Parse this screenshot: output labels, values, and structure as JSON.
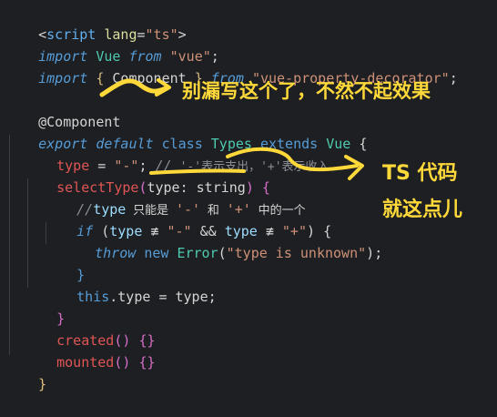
{
  "editor": {
    "lines": [
      {
        "id": "l1",
        "parts": [
          "<",
          "script",
          " lang",
          "=",
          "\"ts\"",
          ">"
        ]
      },
      {
        "id": "l2",
        "parts": [
          "import",
          " ",
          "Vue",
          " ",
          "from",
          " ",
          "\"vue\"",
          ";"
        ]
      },
      {
        "id": "l3",
        "parts": [
          "import",
          " ",
          "{",
          " ",
          "Component",
          " ",
          "}",
          " ",
          "from",
          " ",
          "\"vue-property-decorator\"",
          ";"
        ]
      },
      {
        "id": "l4",
        "parts": []
      },
      {
        "id": "l5",
        "parts": [
          "@Component"
        ]
      },
      {
        "id": "l6",
        "parts": [
          "export",
          " ",
          "default",
          " ",
          "class",
          " ",
          "Types",
          " ",
          "extends",
          " ",
          "Vue",
          " ",
          "{"
        ]
      },
      {
        "id": "l7",
        "parts": [
          "type",
          " ",
          "=",
          " ",
          "\"-\"",
          ";",
          " ",
          "//",
          " ",
          "'-'表示支出，'+'表示收入"
        ]
      },
      {
        "id": "l8",
        "parts": [
          "selectType",
          "(",
          "type",
          ":",
          " ",
          "string",
          ")",
          " ",
          "{"
        ]
      },
      {
        "id": "l9",
        "parts": [
          "//",
          "type",
          " 只能是 ",
          "'-'",
          " 和 ",
          "'+'",
          " 中的一个"
        ]
      },
      {
        "id": "l10",
        "parts": [
          "if",
          " ",
          "(",
          "type",
          " ",
          "≢",
          " ",
          "\"-\"",
          " ",
          "&&",
          " ",
          "type",
          " ",
          "≢",
          " ",
          "\"+\"",
          ")",
          " ",
          "{"
        ]
      },
      {
        "id": "l11",
        "parts": [
          "throw",
          " ",
          "new",
          " ",
          "Error",
          "(",
          "\"type is unknown\"",
          ")",
          ";"
        ]
      },
      {
        "id": "l12",
        "parts": [
          "}"
        ]
      },
      {
        "id": "l13",
        "parts": [
          "this",
          ".",
          "type",
          " ",
          "=",
          " ",
          "type",
          ";"
        ]
      },
      {
        "id": "l14",
        "parts": [
          "}"
        ]
      },
      {
        "id": "l15",
        "parts": [
          "created",
          "()",
          " ",
          "{}"
        ]
      },
      {
        "id": "l16",
        "parts": [
          "mounted",
          "()",
          " ",
          "{}"
        ]
      },
      {
        "id": "l17",
        "parts": [
          "}"
        ]
      }
    ]
  },
  "annotations": {
    "note1": "别漏写这个了，不然不起效果",
    "note2_line1": "TS 代码",
    "note2_line2": "就这点儿"
  },
  "colors": {
    "background": "#1e1f22",
    "annotation": "#ffd93a"
  }
}
